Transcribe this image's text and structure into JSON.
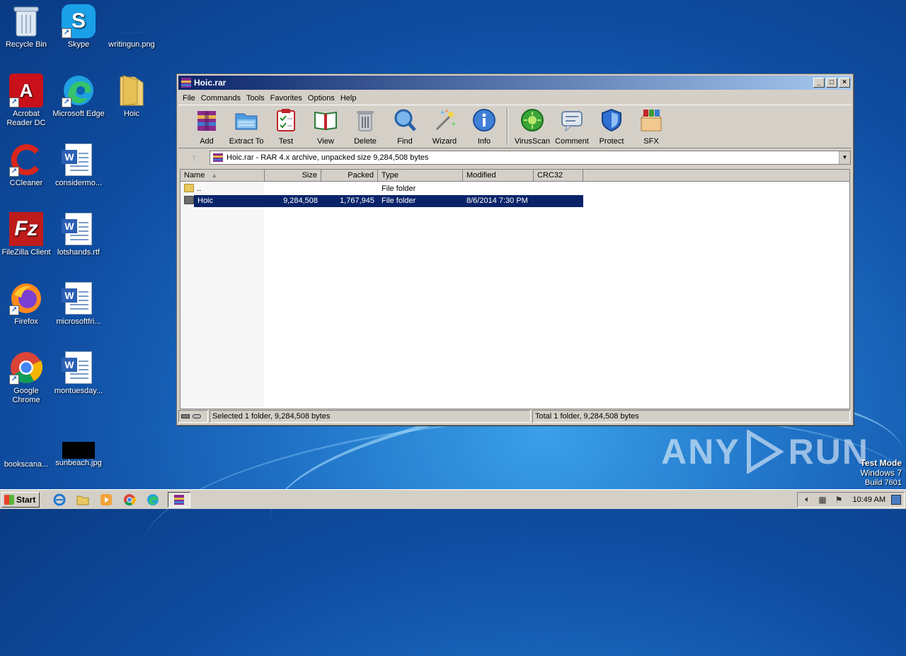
{
  "desktop": {
    "icons": [
      {
        "label": "Recycle Bin"
      },
      {
        "label": "Skype"
      },
      {
        "label": "writingun.png"
      },
      {
        "label": "Acrobat Reader DC"
      },
      {
        "label": "Microsoft Edge"
      },
      {
        "label": "Hoic"
      },
      {
        "label": "CCleaner"
      },
      {
        "label": "considermo..."
      },
      {
        "label": "FileZilla Client"
      },
      {
        "label": "lotshands.rtf"
      },
      {
        "label": "Firefox"
      },
      {
        "label": "microsoftfri..."
      },
      {
        "label": "Google Chrome"
      },
      {
        "label": "montuesday..."
      },
      {
        "label": "bookscana..."
      },
      {
        "label": "sunbeach.jpg"
      }
    ]
  },
  "window": {
    "title": "Hoic.rar",
    "menu": [
      "File",
      "Commands",
      "Tools",
      "Favorites",
      "Options",
      "Help"
    ],
    "toolbar": [
      "Add",
      "Extract To",
      "Test",
      "View",
      "Delete",
      "Find",
      "Wizard",
      "Info",
      "VirusScan",
      "Comment",
      "Protect",
      "SFX"
    ],
    "address": "Hoic.rar - RAR 4.x archive, unpacked size 9,284,508 bytes",
    "columns": [
      "Name",
      "Size",
      "Packed",
      "Type",
      "Modified",
      "CRC32"
    ],
    "rows": [
      {
        "name": "..",
        "size": "",
        "packed": "",
        "type": "File folder",
        "modified": "",
        "crc": ""
      },
      {
        "name": "Hoic",
        "size": "9,284,508",
        "packed": "1,767,945",
        "type": "File folder",
        "modified": "8/6/2014 7:30 PM",
        "crc": ""
      }
    ],
    "status_left": "Selected 1 folder, 9,284,508 bytes",
    "status_right": "Total 1 folder, 9,284,508 bytes"
  },
  "taskbar": {
    "start_label": "Start",
    "clock": "10:49 AM"
  },
  "watermark": {
    "text_left": "ANY",
    "text_right": "RUN"
  },
  "system": {
    "line1": "Test Mode",
    "line2": "Windows 7",
    "line3": "Build 7601"
  }
}
